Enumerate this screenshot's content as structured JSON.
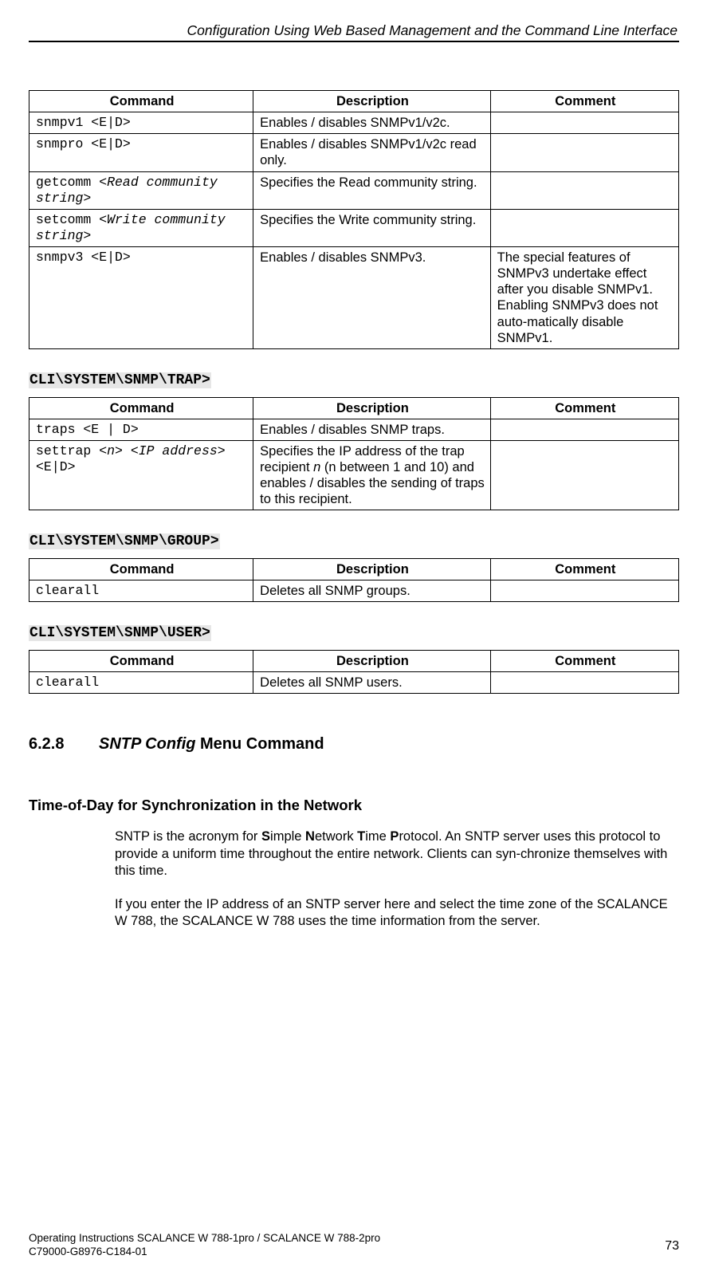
{
  "header": {
    "title": "Configuration Using Web Based Management and the Command Line Interface"
  },
  "table1": {
    "headers": {
      "c1": "Command",
      "c2": "Description",
      "c3": "Comment"
    },
    "rows": [
      {
        "cmd": "snmpv1 <E|D>",
        "desc": "Enables / disables  SNMPv1/v2c.",
        "comment": ""
      },
      {
        "cmd": "snmpro <E|D>",
        "desc": "Enables / disables SNMPv1/v2c read only.",
        "comment": ""
      },
      {
        "cmd_pre": "getcomm ",
        "cmd_param": "<Read community string>",
        "desc": "Specifies the Read community string.",
        "comment": ""
      },
      {
        "cmd_pre": "setcomm ",
        "cmd_param": "<Write community string>",
        "desc": "Specifies the Write community string.",
        "comment": ""
      },
      {
        "cmd": "snmpv3 <E|D>",
        "desc": "Enables / disables SNMPv3.",
        "comment": "The special features of SNMPv3 undertake effect after you disable SNMPv1. Enabling SNMPv3 does not auto-matically disable SNMPv1."
      }
    ]
  },
  "section_trap": {
    "path": "CLI\\SYSTEM\\SNMP\\TRAP>",
    "headers": {
      "c1": "Command",
      "c2": "Description",
      "c3": "Comment"
    },
    "rows": [
      {
        "cmd": "traps  <E | D>",
        "desc": "Enables / disables SNMP traps.",
        "comment": ""
      },
      {
        "cmd_pre": "settrap ",
        "cmd_param": "<n> <IP address>",
        "cmd_post": " <E|D>",
        "desc_pre": "Specifies the IP address of the trap recipient ",
        "desc_ital": "n",
        "desc_post": " (n between 1 and 10) and enables / disables the sending of traps to this recipient.",
        "comment": ""
      }
    ]
  },
  "section_group": {
    "path": "CLI\\SYSTEM\\SNMP\\GROUP>",
    "headers": {
      "c1": "Command",
      "c2": "Description",
      "c3": "Comment"
    },
    "rows": [
      {
        "cmd": "clearall",
        "desc": "Deletes all SNMP groups.",
        "comment": ""
      }
    ]
  },
  "section_user": {
    "path": "CLI\\SYSTEM\\SNMP\\USER>",
    "headers": {
      "c1": "Command",
      "c2": "Description",
      "c3": "Comment"
    },
    "rows": [
      {
        "cmd": "clearall",
        "desc": "Deletes all SNMP users.",
        "comment": ""
      }
    ]
  },
  "heading628": {
    "num": "6.2.8",
    "ital": "SNTP Config",
    "rest": " Menu Command"
  },
  "tod_heading": "Time-of-Day for Synchronization in the Network",
  "para1_pre": "SNTP is the acronym for ",
  "para1_b1": "S",
  "para1_m1": "imple ",
  "para1_b2": "N",
  "para1_m2": "etwork ",
  "para1_b3": "T",
  "para1_m3": "ime ",
  "para1_b4": "P",
  "para1_m4": "rotocol. An SNTP server uses this protocol to provide a uniform time throughout the entire network. Clients can syn-chronize themselves with this time.",
  "para2": "If you enter the IP address of an SNTP server here and select the time zone of the SCALANCE W 788, the SCALANCE W 788 uses the time information from the server.",
  "footer": {
    "line1": "Operating Instructions SCALANCE W 788-1pro / SCALANCE W 788-2pro",
    "line2": "C79000-G8976-C184-01",
    "page": "73"
  }
}
